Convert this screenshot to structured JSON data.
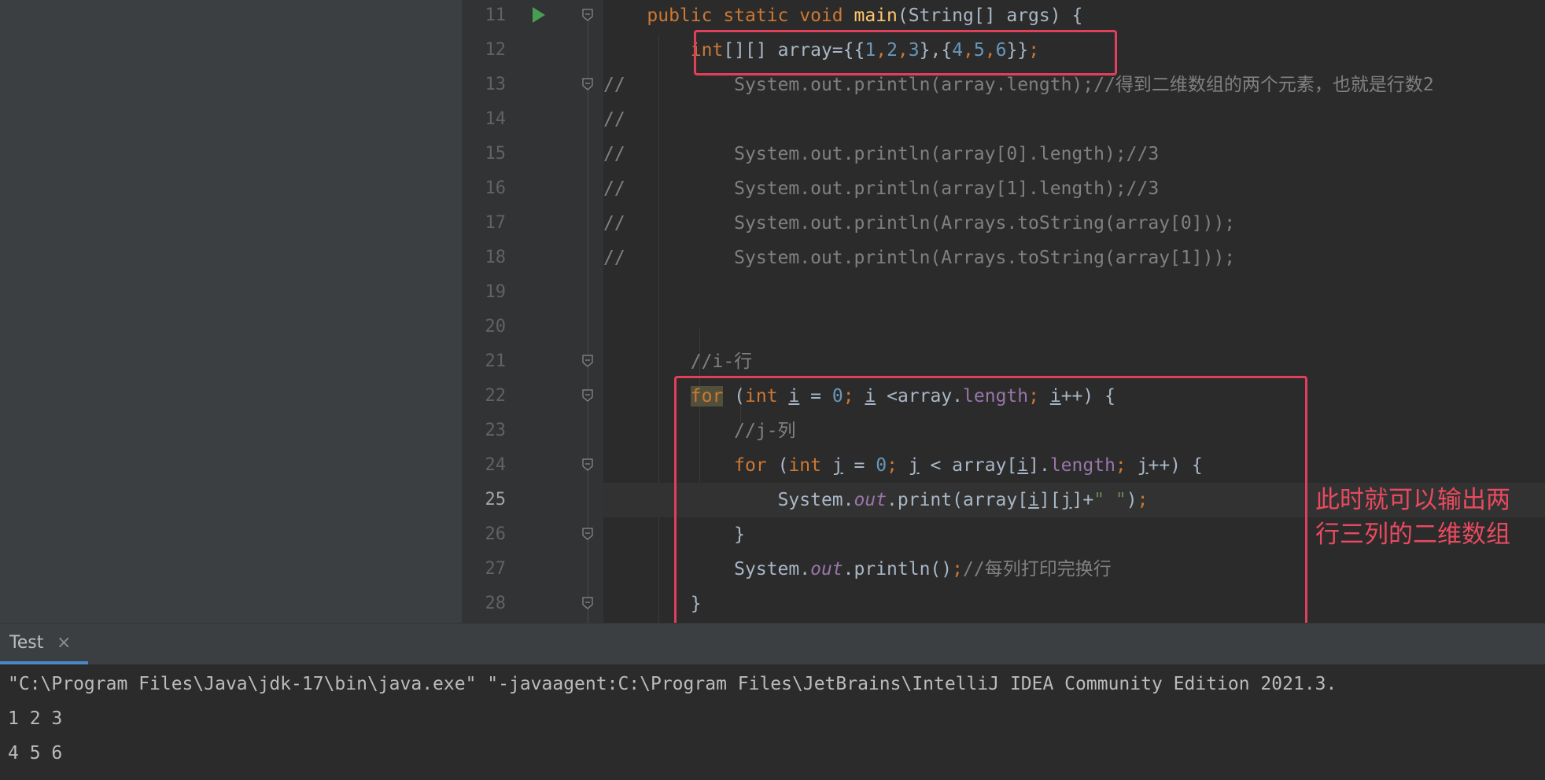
{
  "editor": {
    "lines": [
      {
        "no": "11",
        "tokens": [
          [
            "pad",
            "    "
          ],
          [
            "kw",
            "public static void "
          ],
          [
            "fn",
            "main"
          ],
          [
            "txt",
            "(String[] args) {"
          ]
        ]
      },
      {
        "no": "12",
        "tokens": [
          [
            "pad",
            "        "
          ],
          [
            "kw",
            "int"
          ],
          [
            "txt",
            "[][] array={{"
          ],
          [
            "num",
            "1"
          ],
          [
            "kw",
            ","
          ],
          [
            "num",
            "2"
          ],
          [
            "kw",
            ","
          ],
          [
            "num",
            "3"
          ],
          [
            "txt",
            "},{"
          ],
          [
            "num",
            "4"
          ],
          [
            "kw",
            ","
          ],
          [
            "num",
            "5"
          ],
          [
            "kw",
            ","
          ],
          [
            "num",
            "6"
          ],
          [
            "txt",
            "}}"
          ],
          [
            "kw",
            ";"
          ]
        ]
      },
      {
        "no": "13",
        "tokens": [
          [
            "cm",
            "//          System.out.println(array.length);//得到二维数组的两个元素，也就是行数2"
          ]
        ]
      },
      {
        "no": "14",
        "tokens": [
          [
            "cm",
            "//"
          ]
        ]
      },
      {
        "no": "15",
        "tokens": [
          [
            "cm",
            "//          System.out.println(array[0].length);//3"
          ]
        ]
      },
      {
        "no": "16",
        "tokens": [
          [
            "cm",
            "//          System.out.println(array[1].length);//3"
          ]
        ]
      },
      {
        "no": "17",
        "tokens": [
          [
            "cm",
            "//          System.out.println(Arrays.toString(array[0]));"
          ]
        ]
      },
      {
        "no": "18",
        "tokens": [
          [
            "cm",
            "//          System.out.println(Arrays.toString(array[1]));"
          ]
        ]
      },
      {
        "no": "19",
        "tokens": []
      },
      {
        "no": "20",
        "tokens": []
      },
      {
        "no": "21",
        "tokens": [
          [
            "pad",
            "        "
          ],
          [
            "cm",
            "//i-行"
          ]
        ]
      },
      {
        "no": "22",
        "tokens": [
          [
            "pad",
            "        "
          ],
          [
            "forhl",
            "for"
          ],
          [
            "txt",
            " ("
          ],
          [
            "kw",
            "int "
          ],
          [
            "ul",
            "i"
          ],
          [
            "txt",
            " = "
          ],
          [
            "num",
            "0"
          ],
          [
            "kw",
            "; "
          ],
          [
            "ul",
            "i"
          ],
          [
            "txt",
            " <array."
          ],
          [
            "fld2",
            "length"
          ],
          [
            "kw",
            "; "
          ],
          [
            "ul",
            "i"
          ],
          [
            "txt",
            "++) {"
          ]
        ]
      },
      {
        "no": "23",
        "tokens": [
          [
            "pad",
            "            "
          ],
          [
            "cm",
            "//j-列"
          ]
        ]
      },
      {
        "no": "24",
        "tokens": [
          [
            "pad",
            "            "
          ],
          [
            "kw",
            "for "
          ],
          [
            "txt",
            "("
          ],
          [
            "kw",
            "int "
          ],
          [
            "ul",
            "j"
          ],
          [
            "txt",
            " = "
          ],
          [
            "num",
            "0"
          ],
          [
            "kw",
            "; "
          ],
          [
            "ul",
            "j"
          ],
          [
            "txt",
            " < array["
          ],
          [
            "ul",
            "i"
          ],
          [
            "txt",
            "]."
          ],
          [
            "fld2",
            "length"
          ],
          [
            "kw",
            "; "
          ],
          [
            "ul",
            "j"
          ],
          [
            "txt",
            "++) {"
          ]
        ]
      },
      {
        "no": "25",
        "tokens": [
          [
            "pad",
            "                "
          ],
          [
            "txt",
            "System."
          ],
          [
            "fld",
            "out"
          ],
          [
            "txt",
            ".print(array["
          ],
          [
            "ul",
            "i"
          ],
          [
            "txt",
            "]["
          ],
          [
            "ul",
            "j"
          ],
          [
            "txt",
            "]+"
          ],
          [
            "str",
            "\" \""
          ],
          [
            "txt",
            ")"
          ],
          [
            "kw",
            ";"
          ]
        ]
      },
      {
        "no": "26",
        "tokens": [
          [
            "pad",
            "            "
          ],
          [
            "txt",
            "}"
          ]
        ]
      },
      {
        "no": "27",
        "tokens": [
          [
            "pad",
            "            "
          ],
          [
            "txt",
            "System."
          ],
          [
            "fld",
            "out"
          ],
          [
            "txt",
            ".println()"
          ],
          [
            "kw",
            ";"
          ],
          [
            "cm",
            "//每列打印完换行"
          ]
        ]
      },
      {
        "no": "28",
        "tokens": [
          [
            "pad",
            "        "
          ],
          [
            "txt",
            "}"
          ]
        ]
      }
    ],
    "current_line": "25"
  },
  "annotation": {
    "text": "此时就可以输出两行三列的二维数组",
    "line1": "此时就可以输出两",
    "line2": "行三列的二维数组",
    "color": "#e84a5f"
  },
  "run_panel": {
    "tab_label": "Test",
    "tab_close": "×",
    "console": [
      "\"C:\\Program Files\\Java\\jdk-17\\bin\\java.exe\" \"-javaagent:C:\\Program Files\\JetBrains\\IntelliJ IDEA Community Edition 2021.3.",
      "1 2 3",
      "4 5 6"
    ]
  },
  "icons": {
    "run": "run-gutter-icon",
    "bulb": "intention-bulb-icon",
    "fold": "fold-marker-icon"
  }
}
